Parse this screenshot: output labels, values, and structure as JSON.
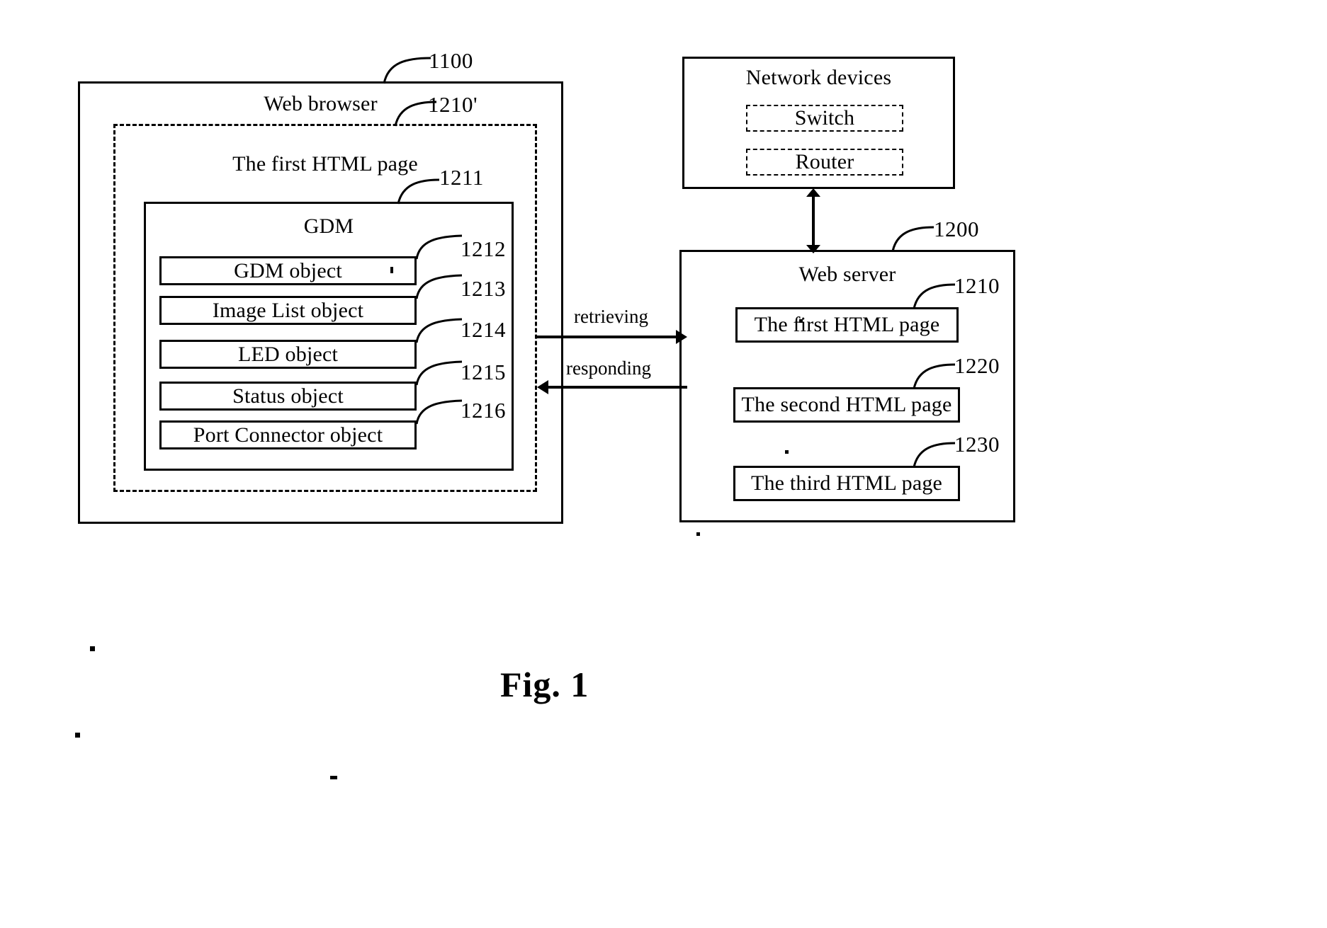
{
  "figure": {
    "caption": "Fig. 1"
  },
  "browser": {
    "title": "Web browser",
    "ref": "1100",
    "html_page": {
      "title": "The first HTML page",
      "ref": "1210'"
    },
    "gdm": {
      "title": "GDM",
      "ref": "1211",
      "objects": [
        {
          "label": "GDM object",
          "ref": "1212"
        },
        {
          "label": "Image List object",
          "ref": "1213"
        },
        {
          "label": "LED object",
          "ref": "1214"
        },
        {
          "label": "Status object",
          "ref": "1215"
        },
        {
          "label": "Port Connector object",
          "ref": "1216"
        }
      ]
    }
  },
  "arrows": {
    "retrieving": "retrieving",
    "responding": "responding"
  },
  "network_devices": {
    "title": "Network devices",
    "devices": [
      {
        "label": "Switch"
      },
      {
        "label": "Router"
      }
    ]
  },
  "web_server": {
    "title": "Web server",
    "ref": "1200",
    "pages": [
      {
        "label": "The first HTML page",
        "ref": "1210"
      },
      {
        "label": "The second HTML page",
        "ref": "1220"
      },
      {
        "label": "The third HTML page",
        "ref": "1230"
      }
    ]
  }
}
